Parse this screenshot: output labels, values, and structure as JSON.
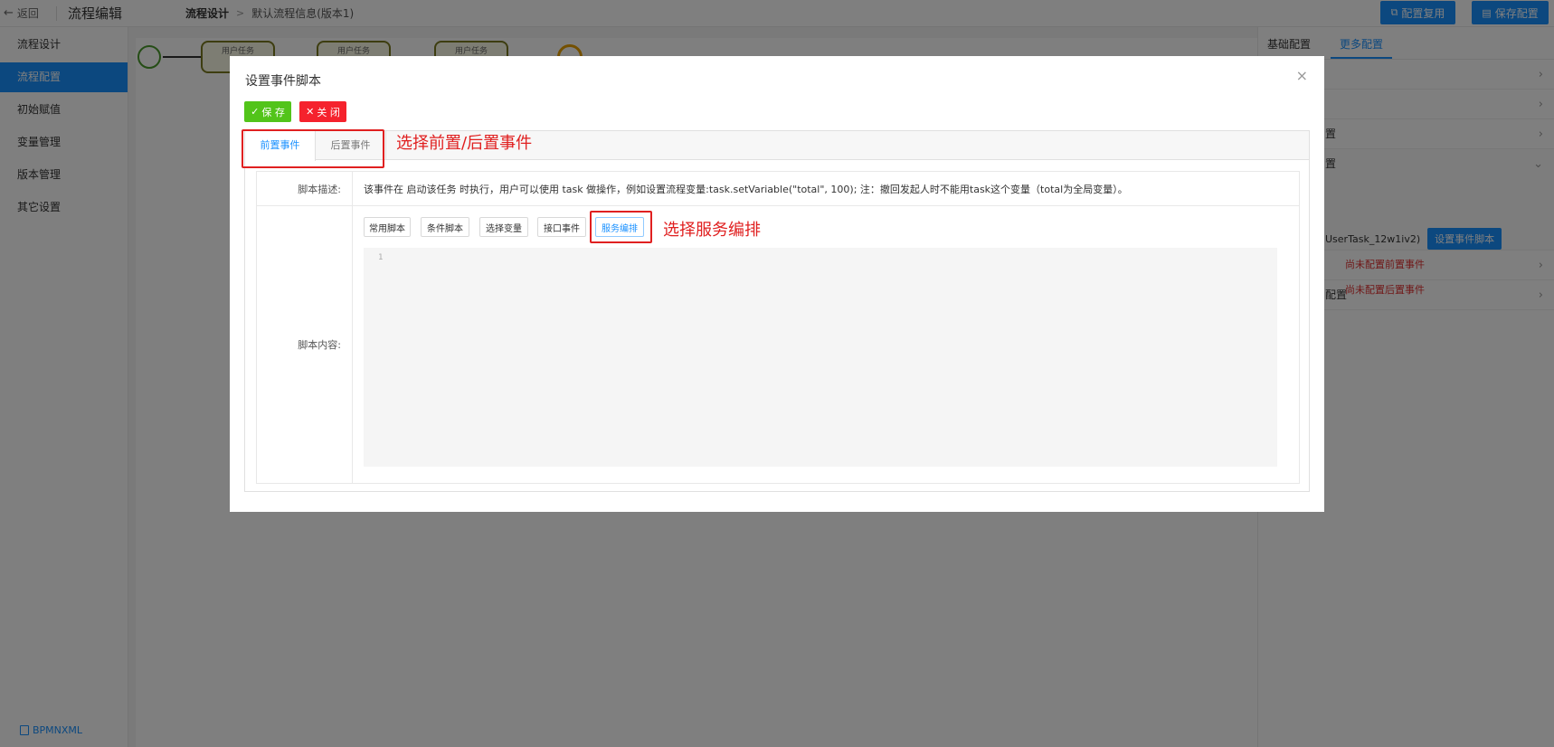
{
  "topbar": {
    "back_label": "返回",
    "app_title": "流程编辑",
    "crumb_a": "流程设计",
    "crumb_sep": ">",
    "crumb_b": "默认流程信息(版本1)",
    "config_copy_label": "配置复用",
    "save_config_label": "保存配置"
  },
  "sidebar": {
    "items": [
      {
        "label": "流程设计"
      },
      {
        "label": "流程配置"
      },
      {
        "label": "初始赋值"
      },
      {
        "label": "变量管理"
      },
      {
        "label": "版本管理"
      },
      {
        "label": "其它设置"
      }
    ],
    "active_index": 1,
    "bpmn_label": "BPMNXML"
  },
  "canvas": {
    "nodes": [
      "用户任务",
      "用户任务",
      "用户任务"
    ]
  },
  "rpanel": {
    "tabs": [
      "基础配置",
      "更多配置"
    ],
    "active_tab": 1,
    "row4_text": "置",
    "row6_text": "置",
    "row7_text": "配置",
    "task_id": "UserTask_12w1iv2)",
    "set_script_label": "设置事件脚本",
    "warn_pre": "尚未配置前置事件",
    "warn_post": "尚未配置后置事件"
  },
  "modal": {
    "title": "设置事件脚本",
    "close_glyph": "×",
    "save_label": "保 存",
    "close_label": "关 闭",
    "tabs": [
      "前置事件",
      "后置事件"
    ],
    "active_tab": 0,
    "desc_label": "脚本描述:",
    "desc_text": "该事件在 启动该任务 时执行，用户可以使用 task 做操作，例如设置流程变量:task.setVariable(\"total\", 100); 注：撤回发起人时不能用task这个变量（total为全局变量）。",
    "content_label": "脚本内容:",
    "script_buttons": [
      "常用脚本",
      "条件脚本",
      "选择变量",
      "接口事件",
      "服务编排"
    ],
    "editor_line": "1"
  },
  "annotations": {
    "note_tabs": "选择前置/后置事件",
    "note_service": "选择服务编排"
  },
  "colors": {
    "primary": "#1890ff",
    "success": "#52c41a",
    "danger": "#f5222d",
    "annotation": "#e02020"
  }
}
